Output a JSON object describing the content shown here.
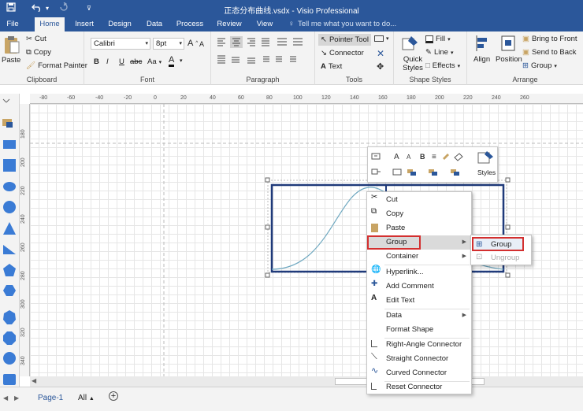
{
  "window": {
    "title": "正态分布曲线.vsdx - Visio Professional"
  },
  "tabs": [
    {
      "label": "File",
      "active": false
    },
    {
      "label": "Home",
      "active": true
    },
    {
      "label": "Insert",
      "active": false
    },
    {
      "label": "Design",
      "active": false
    },
    {
      "label": "Data",
      "active": false
    },
    {
      "label": "Process",
      "active": false
    },
    {
      "label": "Review",
      "active": false
    },
    {
      "label": "View",
      "active": false
    }
  ],
  "tellme": "Tell me what you want to do...",
  "ribbon": {
    "clipboard": {
      "label": "Clipboard",
      "paste": "Paste",
      "cut": "Cut",
      "copy": "Copy",
      "format_painter": "Format Painter"
    },
    "font": {
      "label": "Font",
      "name": "Calibri",
      "size": "8pt",
      "bold": "B",
      "italic": "I",
      "underline": "U",
      "strike": "abc",
      "case": "Aa",
      "grow": "A",
      "shrink": "A",
      "color": "A"
    },
    "paragraph": {
      "label": "Paragraph"
    },
    "tools": {
      "label": "Tools",
      "pointer": "Pointer Tool",
      "connector": "Connector",
      "text": "Text"
    },
    "shape_styles": {
      "label": "Shape Styles",
      "quick_styles": "Quick Styles",
      "fill": "Fill",
      "line": "Line",
      "effects": "Effects"
    },
    "arrange": {
      "label": "Arrange",
      "align": "Align",
      "position": "Position",
      "bring_front": "Bring to Front",
      "send_back": "Send to Back",
      "group": "Group"
    }
  },
  "ruler_h": [
    "-80",
    "-60",
    "-40",
    "-20",
    "0",
    "20",
    "40",
    "60",
    "80",
    "100",
    "120",
    "140",
    "160",
    "180",
    "200",
    "220",
    "240",
    "260"
  ],
  "ruler_v": [
    "180",
    "200",
    "220",
    "240",
    "260",
    "280",
    "300",
    "320",
    "340"
  ],
  "mini_toolbar": {
    "styles": "Styles"
  },
  "context_menu": {
    "items": [
      {
        "label": "Cut",
        "icon": "scissors-icon",
        "submenu": false
      },
      {
        "label": "Copy",
        "icon": "copy-icon",
        "submenu": false
      },
      {
        "label": "Paste",
        "icon": "paste-icon",
        "submenu": false
      },
      {
        "label": "Group",
        "icon": "",
        "submenu": true
      },
      {
        "label": "Container",
        "icon": "",
        "submenu": true
      },
      {
        "label": "Hyperlink...",
        "icon": "hyperlink-icon",
        "submenu": false
      },
      {
        "label": "Add Comment",
        "icon": "comment-icon",
        "submenu": false
      },
      {
        "label": "Edit Text",
        "icon": "text-icon",
        "submenu": false
      },
      {
        "label": "Data",
        "icon": "",
        "submenu": true
      },
      {
        "label": "Format Shape",
        "icon": "",
        "submenu": false
      },
      {
        "label": "Right-Angle Connector",
        "icon": "right-angle-connector-icon",
        "submenu": false
      },
      {
        "label": "Straight Connector",
        "icon": "straight-connector-icon",
        "submenu": false
      },
      {
        "label": "Curved Connector",
        "icon": "curved-connector-icon",
        "submenu": false
      },
      {
        "label": "Reset Connector",
        "icon": "reset-connector-icon",
        "submenu": false
      }
    ]
  },
  "submenu": {
    "group": "Group",
    "ungroup": "Ungroup"
  },
  "status": {
    "page": "Page-1",
    "all": "All"
  },
  "colors": {
    "accent": "#2b579a",
    "highlight_red": "#d32f2f",
    "shape_stroke": "#1f3a7a",
    "curve": "#6fa8c0"
  }
}
